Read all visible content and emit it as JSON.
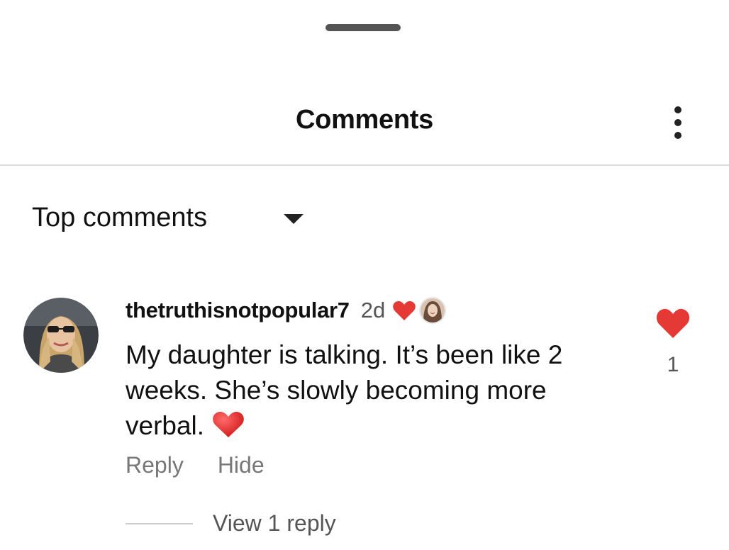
{
  "header": {
    "title": "Comments",
    "more_icon": "more-vertical-icon"
  },
  "sort": {
    "label": "Top comments",
    "caret_icon": "caret-down-icon"
  },
  "comment": {
    "username": "thetruthisnotpopular7",
    "time": "2d",
    "creator_liked_icon": "heart-icon",
    "text": "My daughter is talking. It’s been like 2 weeks. She’s slowly becoming more verbal.",
    "emoji": "red-heart-emoji",
    "likes": "1",
    "actions": {
      "reply": "Reply",
      "hide": "Hide"
    },
    "view_replies": "View 1 reply"
  },
  "colors": {
    "heart": "#e53935",
    "text": "#111111",
    "muted": "#777777",
    "divider": "#dcdcdc"
  }
}
